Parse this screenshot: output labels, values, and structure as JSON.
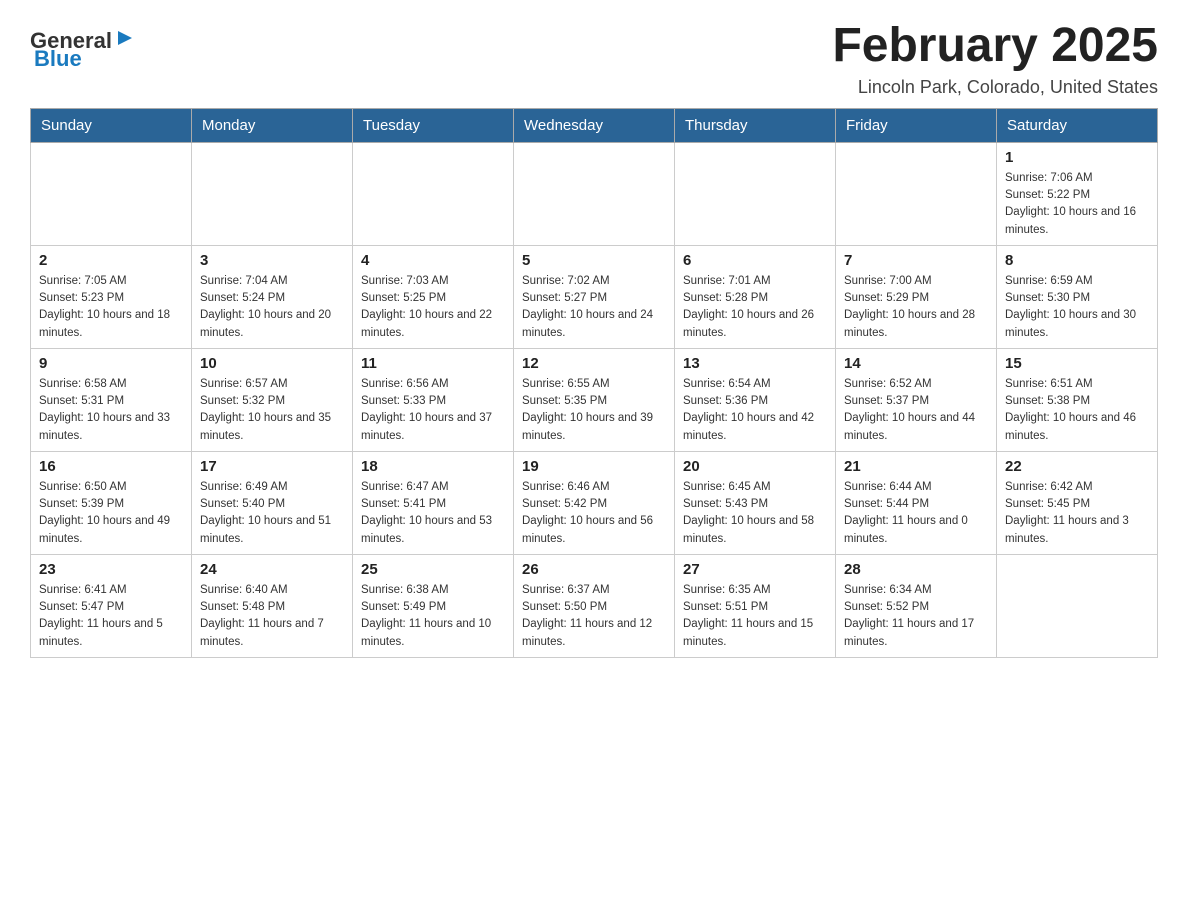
{
  "header": {
    "logo_general": "General",
    "logo_blue": "Blue",
    "title": "February 2025",
    "location": "Lincoln Park, Colorado, United States"
  },
  "weekdays": [
    "Sunday",
    "Monday",
    "Tuesday",
    "Wednesday",
    "Thursday",
    "Friday",
    "Saturday"
  ],
  "weeks": [
    [
      {
        "day": "",
        "sunrise": "",
        "sunset": "",
        "daylight": ""
      },
      {
        "day": "",
        "sunrise": "",
        "sunset": "",
        "daylight": ""
      },
      {
        "day": "",
        "sunrise": "",
        "sunset": "",
        "daylight": ""
      },
      {
        "day": "",
        "sunrise": "",
        "sunset": "",
        "daylight": ""
      },
      {
        "day": "",
        "sunrise": "",
        "sunset": "",
        "daylight": ""
      },
      {
        "day": "",
        "sunrise": "",
        "sunset": "",
        "daylight": ""
      },
      {
        "day": "1",
        "sunrise": "Sunrise: 7:06 AM",
        "sunset": "Sunset: 5:22 PM",
        "daylight": "Daylight: 10 hours and 16 minutes."
      }
    ],
    [
      {
        "day": "2",
        "sunrise": "Sunrise: 7:05 AM",
        "sunset": "Sunset: 5:23 PM",
        "daylight": "Daylight: 10 hours and 18 minutes."
      },
      {
        "day": "3",
        "sunrise": "Sunrise: 7:04 AM",
        "sunset": "Sunset: 5:24 PM",
        "daylight": "Daylight: 10 hours and 20 minutes."
      },
      {
        "day": "4",
        "sunrise": "Sunrise: 7:03 AM",
        "sunset": "Sunset: 5:25 PM",
        "daylight": "Daylight: 10 hours and 22 minutes."
      },
      {
        "day": "5",
        "sunrise": "Sunrise: 7:02 AM",
        "sunset": "Sunset: 5:27 PM",
        "daylight": "Daylight: 10 hours and 24 minutes."
      },
      {
        "day": "6",
        "sunrise": "Sunrise: 7:01 AM",
        "sunset": "Sunset: 5:28 PM",
        "daylight": "Daylight: 10 hours and 26 minutes."
      },
      {
        "day": "7",
        "sunrise": "Sunrise: 7:00 AM",
        "sunset": "Sunset: 5:29 PM",
        "daylight": "Daylight: 10 hours and 28 minutes."
      },
      {
        "day": "8",
        "sunrise": "Sunrise: 6:59 AM",
        "sunset": "Sunset: 5:30 PM",
        "daylight": "Daylight: 10 hours and 30 minutes."
      }
    ],
    [
      {
        "day": "9",
        "sunrise": "Sunrise: 6:58 AM",
        "sunset": "Sunset: 5:31 PM",
        "daylight": "Daylight: 10 hours and 33 minutes."
      },
      {
        "day": "10",
        "sunrise": "Sunrise: 6:57 AM",
        "sunset": "Sunset: 5:32 PM",
        "daylight": "Daylight: 10 hours and 35 minutes."
      },
      {
        "day": "11",
        "sunrise": "Sunrise: 6:56 AM",
        "sunset": "Sunset: 5:33 PM",
        "daylight": "Daylight: 10 hours and 37 minutes."
      },
      {
        "day": "12",
        "sunrise": "Sunrise: 6:55 AM",
        "sunset": "Sunset: 5:35 PM",
        "daylight": "Daylight: 10 hours and 39 minutes."
      },
      {
        "day": "13",
        "sunrise": "Sunrise: 6:54 AM",
        "sunset": "Sunset: 5:36 PM",
        "daylight": "Daylight: 10 hours and 42 minutes."
      },
      {
        "day": "14",
        "sunrise": "Sunrise: 6:52 AM",
        "sunset": "Sunset: 5:37 PM",
        "daylight": "Daylight: 10 hours and 44 minutes."
      },
      {
        "day": "15",
        "sunrise": "Sunrise: 6:51 AM",
        "sunset": "Sunset: 5:38 PM",
        "daylight": "Daylight: 10 hours and 46 minutes."
      }
    ],
    [
      {
        "day": "16",
        "sunrise": "Sunrise: 6:50 AM",
        "sunset": "Sunset: 5:39 PM",
        "daylight": "Daylight: 10 hours and 49 minutes."
      },
      {
        "day": "17",
        "sunrise": "Sunrise: 6:49 AM",
        "sunset": "Sunset: 5:40 PM",
        "daylight": "Daylight: 10 hours and 51 minutes."
      },
      {
        "day": "18",
        "sunrise": "Sunrise: 6:47 AM",
        "sunset": "Sunset: 5:41 PM",
        "daylight": "Daylight: 10 hours and 53 minutes."
      },
      {
        "day": "19",
        "sunrise": "Sunrise: 6:46 AM",
        "sunset": "Sunset: 5:42 PM",
        "daylight": "Daylight: 10 hours and 56 minutes."
      },
      {
        "day": "20",
        "sunrise": "Sunrise: 6:45 AM",
        "sunset": "Sunset: 5:43 PM",
        "daylight": "Daylight: 10 hours and 58 minutes."
      },
      {
        "day": "21",
        "sunrise": "Sunrise: 6:44 AM",
        "sunset": "Sunset: 5:44 PM",
        "daylight": "Daylight: 11 hours and 0 minutes."
      },
      {
        "day": "22",
        "sunrise": "Sunrise: 6:42 AM",
        "sunset": "Sunset: 5:45 PM",
        "daylight": "Daylight: 11 hours and 3 minutes."
      }
    ],
    [
      {
        "day": "23",
        "sunrise": "Sunrise: 6:41 AM",
        "sunset": "Sunset: 5:47 PM",
        "daylight": "Daylight: 11 hours and 5 minutes."
      },
      {
        "day": "24",
        "sunrise": "Sunrise: 6:40 AM",
        "sunset": "Sunset: 5:48 PM",
        "daylight": "Daylight: 11 hours and 7 minutes."
      },
      {
        "day": "25",
        "sunrise": "Sunrise: 6:38 AM",
        "sunset": "Sunset: 5:49 PM",
        "daylight": "Daylight: 11 hours and 10 minutes."
      },
      {
        "day": "26",
        "sunrise": "Sunrise: 6:37 AM",
        "sunset": "Sunset: 5:50 PM",
        "daylight": "Daylight: 11 hours and 12 minutes."
      },
      {
        "day": "27",
        "sunrise": "Sunrise: 6:35 AM",
        "sunset": "Sunset: 5:51 PM",
        "daylight": "Daylight: 11 hours and 15 minutes."
      },
      {
        "day": "28",
        "sunrise": "Sunrise: 6:34 AM",
        "sunset": "Sunset: 5:52 PM",
        "daylight": "Daylight: 11 hours and 17 minutes."
      },
      {
        "day": "",
        "sunrise": "",
        "sunset": "",
        "daylight": ""
      }
    ]
  ]
}
